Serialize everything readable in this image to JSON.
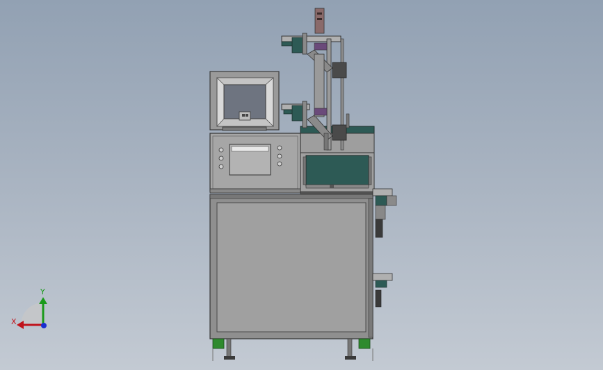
{
  "viewport": {
    "name": "cad-3d-viewport",
    "background_top": "#92a1b3",
    "background_bottom": "#c3cad3"
  },
  "triad": {
    "x_label": "X",
    "y_label": "Y",
    "x_color": "#c0131b",
    "y_color": "#1a9a1a",
    "z_color": "#1a2fd0"
  },
  "model": {
    "frame_color": "#8f8f8f",
    "panel_color": "#a6a6a6",
    "accent_green": "#2d5a55",
    "monitor_screen": "#6e7480",
    "foot_green": "#2e8a2e"
  }
}
